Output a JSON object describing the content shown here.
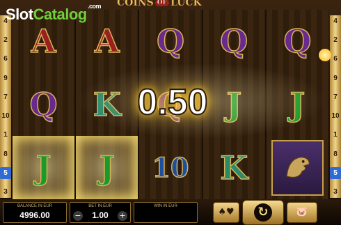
{
  "logo": {
    "brand_part1": "Slot",
    "brand_part2": "Catalog",
    "domain": ".com"
  },
  "game_title": {
    "part1": "COINS",
    "of": "OF",
    "part2": "LUCK"
  },
  "paylines_left": [
    "4",
    "2",
    "6",
    "9",
    "7",
    "10",
    "1",
    "8",
    "5",
    "3"
  ],
  "paylines_right": [
    "4",
    "2",
    "6",
    "9",
    "7",
    "10",
    "1",
    "8",
    "5",
    "3"
  ],
  "active_payline": "5",
  "win_amount": "0.50",
  "reels": [
    [
      {
        "sym": "A"
      },
      {
        "sym": "Q"
      },
      {
        "sym": "J",
        "win": true
      }
    ],
    [
      {
        "sym": "A"
      },
      {
        "sym": "K"
      },
      {
        "sym": "J",
        "win": true
      }
    ],
    [
      {
        "sym": "Q"
      },
      {
        "sym": "Q"
      },
      {
        "sym": "10"
      }
    ],
    [
      {
        "sym": "Q"
      },
      {
        "sym": "J"
      },
      {
        "sym": "K"
      }
    ],
    [
      {
        "sym": "Q"
      },
      {
        "sym": "J"
      },
      {
        "sym": "eagle"
      }
    ]
  ],
  "bottom_bar": {
    "balance_label": "BALANCE IN EUR",
    "balance_value": "4996.00",
    "bet_label": "BET IN EUR",
    "bet_value": "1.00",
    "bet_minus": "−",
    "bet_plus": "+",
    "win_label": "WIN IN EUR",
    "win_value": "",
    "cards_icon": "cards-icon",
    "spin_icon": "refresh-icon",
    "autoplay_icon": "piggy-bank-icon"
  },
  "colors": {
    "accent_gold": "#e9c46a",
    "win_glow": "#ffd84a",
    "payline_active": "#2f6bd6"
  }
}
